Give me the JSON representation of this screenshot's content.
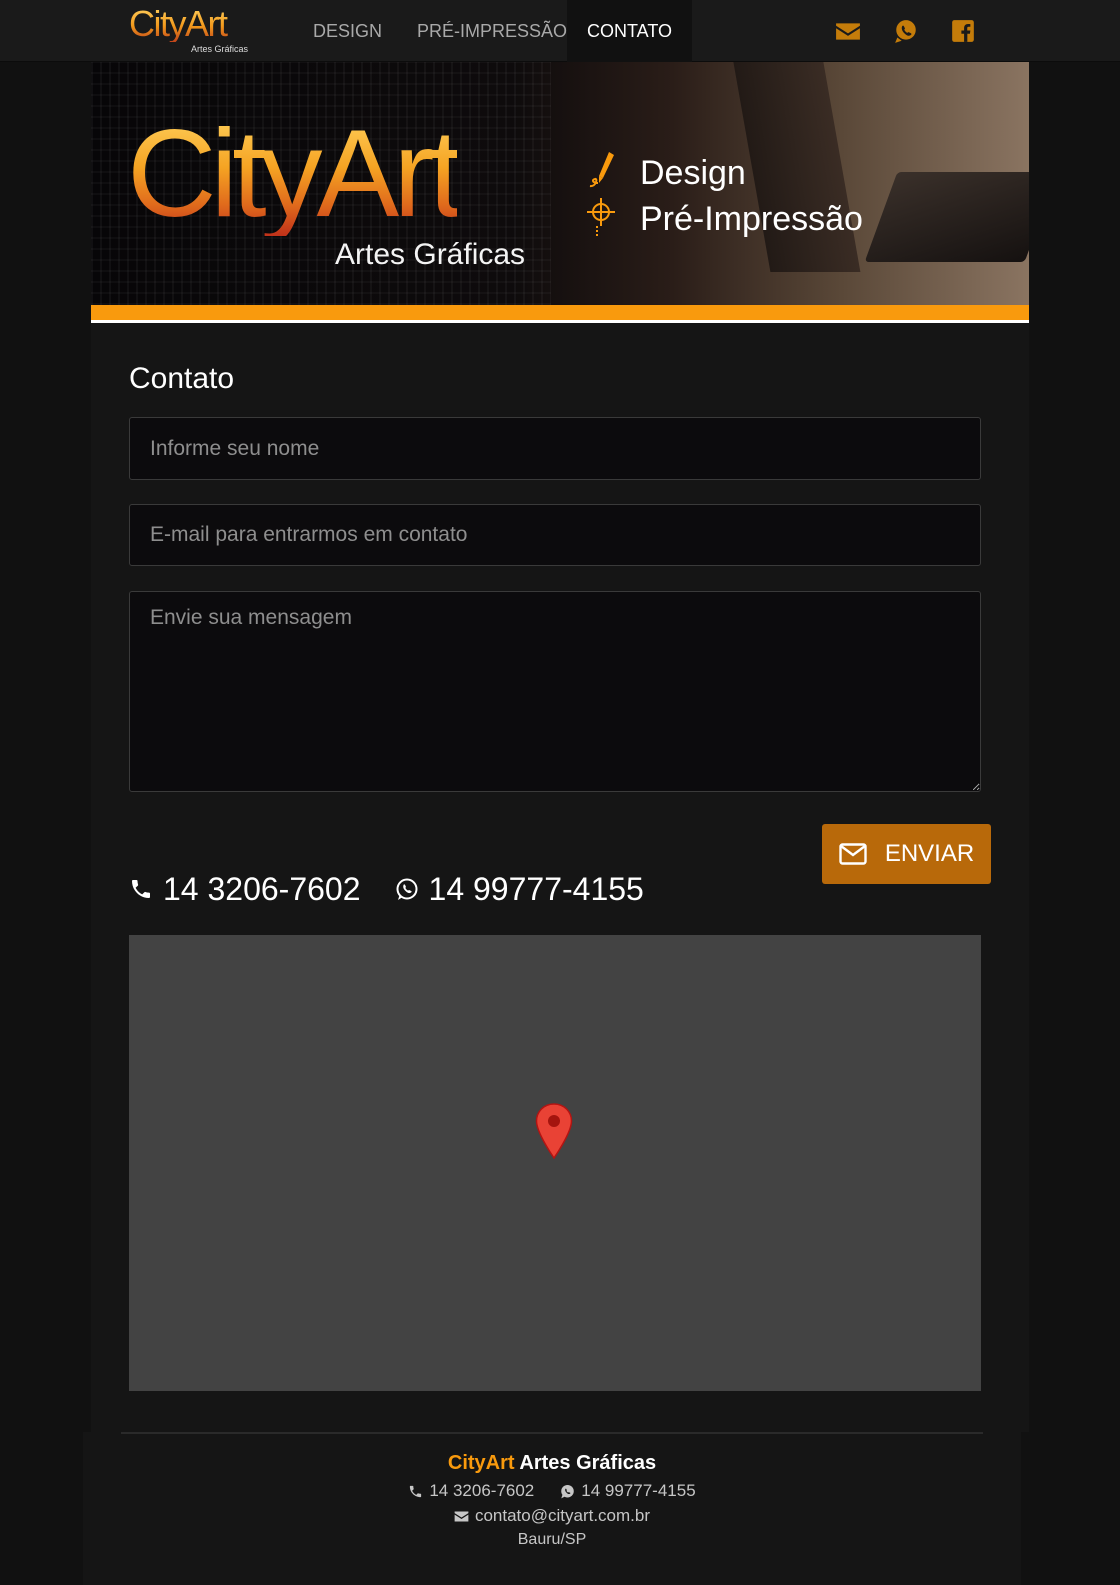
{
  "nav": {
    "logo_main": "CityArt",
    "logo_sub": "Artes Gráficas",
    "links": [
      "DESIGN",
      "PRÉ-IMPRESSÃO",
      "CONTATO"
    ],
    "active": "CONTATO",
    "icons": [
      "envelope-icon",
      "whatsapp-icon",
      "facebook-icon"
    ]
  },
  "banner": {
    "logo_main": "CityArt",
    "logo_sub": "Artes Gráficas",
    "services": [
      "Design",
      "Pré-Impressão"
    ]
  },
  "contact": {
    "title": "Contato",
    "name_placeholder": "Informe seu nome",
    "email_placeholder": "E-mail para entrarmos em contato",
    "message_placeholder": "Envie sua mensagem",
    "send_label": "ENVIAR",
    "phone": "14 3206-7602",
    "whatsapp": "14 99777-4155"
  },
  "footer": {
    "brand_accent": "CityArt",
    "brand_rest": "Artes Gráficas",
    "phone": "14 3206-7602",
    "whatsapp": "14 99777-4155",
    "email": "contato@cityart.com.br",
    "city": "Bauru/SP"
  },
  "colors": {
    "accent": "#f99a0d",
    "button": "#b8690a",
    "background": "#111111"
  }
}
